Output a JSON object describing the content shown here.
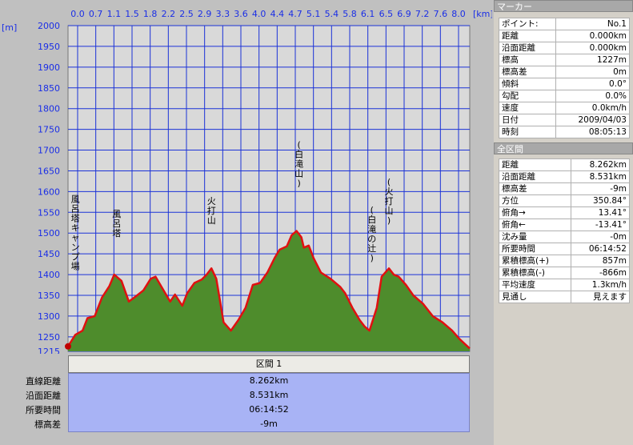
{
  "chart_data": {
    "type": "area",
    "xlabel": "[km]",
    "ylabel": "[m]",
    "xlim": [
      0,
      8.262
    ],
    "ylim": [
      1215,
      2000
    ],
    "x_ticks": [
      "0.0",
      "0.7",
      "1.1",
      "1.5",
      "1.8",
      "2.2",
      "2.5",
      "2.9",
      "3.3",
      "3.6",
      "4.0",
      "4.4",
      "4.7",
      "5.1",
      "5.4",
      "5.8",
      "6.1",
      "6.5",
      "6.9",
      "7.2",
      "7.6",
      "8.0"
    ],
    "y_ticks": [
      2000,
      1950,
      1900,
      1850,
      1800,
      1750,
      1700,
      1650,
      1600,
      1550,
      1500,
      1450,
      1400,
      1350,
      1300,
      1250,
      1215
    ],
    "x": [
      0,
      0.15,
      0.3,
      0.4,
      0.55,
      0.7,
      0.85,
      0.95,
      1.1,
      1.25,
      1.4,
      1.55,
      1.7,
      1.8,
      1.95,
      2.1,
      2.2,
      2.35,
      2.45,
      2.6,
      2.75,
      2.85,
      2.95,
      3.05,
      3.2,
      3.35,
      3.5,
      3.65,
      3.8,
      3.95,
      4.1,
      4.25,
      4.35,
      4.5,
      4.6,
      4.7,
      4.8,
      4.85,
      4.95,
      5.05,
      5.2,
      5.4,
      5.6,
      5.7,
      5.85,
      6.0,
      6.1,
      6.2,
      6.35,
      6.45,
      6.6,
      6.7,
      6.8,
      6.95,
      7.1,
      7.3,
      7.5,
      7.7,
      7.9,
      8.05,
      8.262
    ],
    "y": [
      1227,
      1255,
      1265,
      1295,
      1300,
      1345,
      1372,
      1400,
      1385,
      1335,
      1348,
      1362,
      1390,
      1395,
      1365,
      1335,
      1352,
      1325,
      1355,
      1380,
      1388,
      1400,
      1415,
      1390,
      1285,
      1265,
      1290,
      1320,
      1375,
      1380,
      1405,
      1440,
      1460,
      1468,
      1495,
      1505,
      1490,
      1465,
      1470,
      1440,
      1405,
      1390,
      1370,
      1355,
      1320,
      1290,
      1275,
      1265,
      1320,
      1395,
      1415,
      1400,
      1395,
      1375,
      1350,
      1330,
      1300,
      1285,
      1265,
      1245,
      1222
    ],
    "annotations": [
      {
        "text": "風呂塔キャンプ場",
        "x": 0.15,
        "y": 1390
      },
      {
        "text": "風呂塔",
        "x": 1.0,
        "y": 1470
      },
      {
        "text": "火打山",
        "x": 2.95,
        "y": 1500
      },
      {
        "text": "(白滝山)",
        "x": 4.75,
        "y": 1590
      },
      {
        "text": "(白滝の辻)",
        "x": 6.25,
        "y": 1410
      },
      {
        "text": "(火打山)",
        "x": 6.6,
        "y": 1500
      }
    ]
  },
  "marker": {
    "title": "マーカー",
    "rows": [
      {
        "k": "ポイント:",
        "v": "No.1"
      },
      {
        "k": "距離",
        "v": "0.000km"
      },
      {
        "k": "沿面距離",
        "v": "0.000km"
      },
      {
        "k": "標高",
        "v": "1227m"
      },
      {
        "k": "標高差",
        "v": "0m"
      },
      {
        "k": "傾斜",
        "v": "0.0°"
      },
      {
        "k": "勾配",
        "v": "0.0%"
      },
      {
        "k": "速度",
        "v": "0.0km/h"
      },
      {
        "k": "日付",
        "v": "2009/04/03"
      },
      {
        "k": "時刻",
        "v": "08:05:13"
      }
    ]
  },
  "whole": {
    "title": "全区間",
    "rows": [
      {
        "k": "距離",
        "v": "8.262km"
      },
      {
        "k": "沿面距離",
        "v": "8.531km"
      },
      {
        "k": "標高差",
        "v": "-9m"
      },
      {
        "k": "方位",
        "v": "350.84°"
      },
      {
        "k": "俯角→",
        "v": "13.41°"
      },
      {
        "k": "俯角←",
        "v": "-13.41°"
      },
      {
        "k": "沈み量",
        "v": "-0m"
      },
      {
        "k": "所要時間",
        "v": "06:14:52"
      },
      {
        "k": "累積標高(+)",
        "v": "857m"
      },
      {
        "k": "累積標高(-)",
        "v": "-866m"
      },
      {
        "k": "平均速度",
        "v": "1.3km/h"
      },
      {
        "k": "見通し",
        "v": "見えます"
      }
    ]
  },
  "segment": {
    "header": "区間 1",
    "labels": [
      "直線距離",
      "沿面距離",
      "所要時間",
      "標高差"
    ],
    "values": [
      "8.262km",
      "8.531km",
      "06:14:52",
      "-9m"
    ]
  },
  "colors": {
    "fill": "#4e8c2c",
    "line": "#e01010",
    "grid": "#1b32d8",
    "plot_bg": "#d9d9d9",
    "axis_text": "#1a2ee6"
  }
}
